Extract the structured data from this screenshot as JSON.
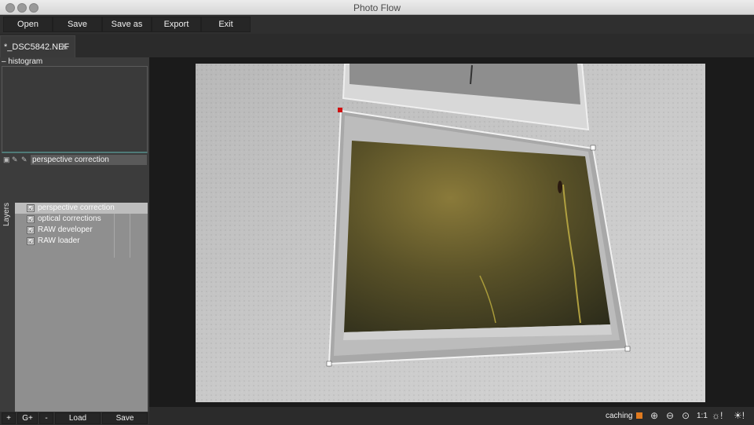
{
  "window": {
    "title": "Photo Flow"
  },
  "toolbar": {
    "buttons": [
      "Open",
      "Save",
      "Save as",
      "Export",
      "Exit"
    ]
  },
  "tab": {
    "label": "*_DSC5842.NEF",
    "close": "✕"
  },
  "histogram": {
    "label": "– histogram"
  },
  "selected_layer": {
    "name": "perspective correction"
  },
  "layers_panel": {
    "title": "Layers",
    "items": [
      {
        "name": "perspective correction",
        "checked": "☑",
        "selected": true
      },
      {
        "name": "optical corrections",
        "checked": "☑",
        "selected": false
      },
      {
        "name": "RAW developer",
        "checked": "☑",
        "selected": false
      },
      {
        "name": "RAW loader",
        "checked": "☑",
        "selected": false
      }
    ]
  },
  "layer_buttons": {
    "add": "+",
    "group": "G+",
    "remove": "-",
    "load": "Load",
    "save": "Save"
  },
  "status": {
    "caching_label": "caching",
    "zoom_in": "⊕",
    "zoom_out": "⊖",
    "zoom_fit": "⊙",
    "zoom_100": "1:1",
    "icons": [
      "sun-warning-icon",
      "sun-warning-icon"
    ]
  },
  "colors": {
    "cache_indicator": "#e07a1f",
    "handle_selected": "#d01010"
  }
}
